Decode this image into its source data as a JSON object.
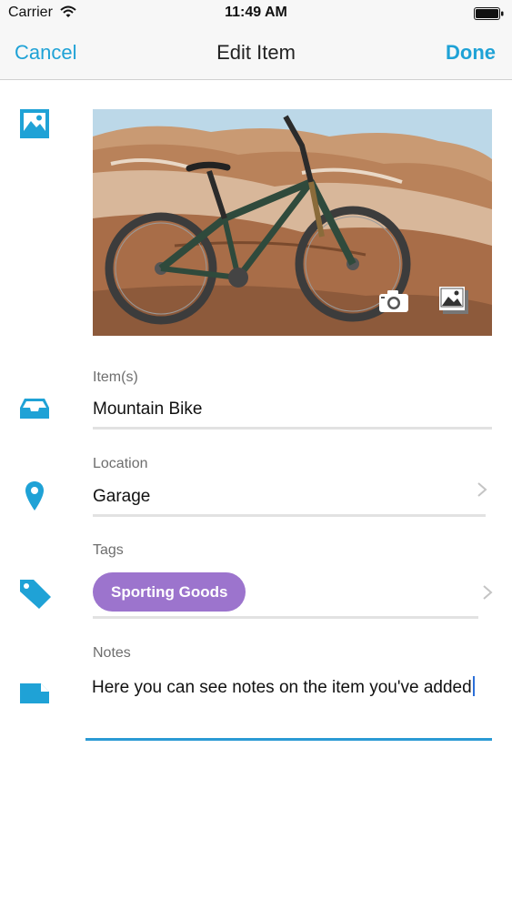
{
  "status_bar": {
    "carrier": "Carrier",
    "time": "11:49 AM"
  },
  "nav": {
    "cancel_label": "Cancel",
    "title": "Edit Item",
    "done_label": "Done"
  },
  "photo": {
    "icon": "image-icon",
    "camera_icon": "camera-icon",
    "gallery_icon": "gallery-icon"
  },
  "fields": {
    "item": {
      "label": "Item(s)",
      "value": "Mountain Bike",
      "icon": "inbox-tray-icon"
    },
    "location": {
      "label": "Location",
      "value": "Garage",
      "icon": "map-pin-icon"
    },
    "tags": {
      "label": "Tags",
      "chip": "Sporting Goods",
      "icon": "tag-icon"
    },
    "notes": {
      "label": "Notes",
      "value": "Here you can see notes on the item you've added",
      "icon": "note-icon"
    }
  },
  "colors": {
    "accent": "#1fa2d6",
    "tag_chip": "#9c74cd",
    "focus_line": "#2b9ad4"
  }
}
